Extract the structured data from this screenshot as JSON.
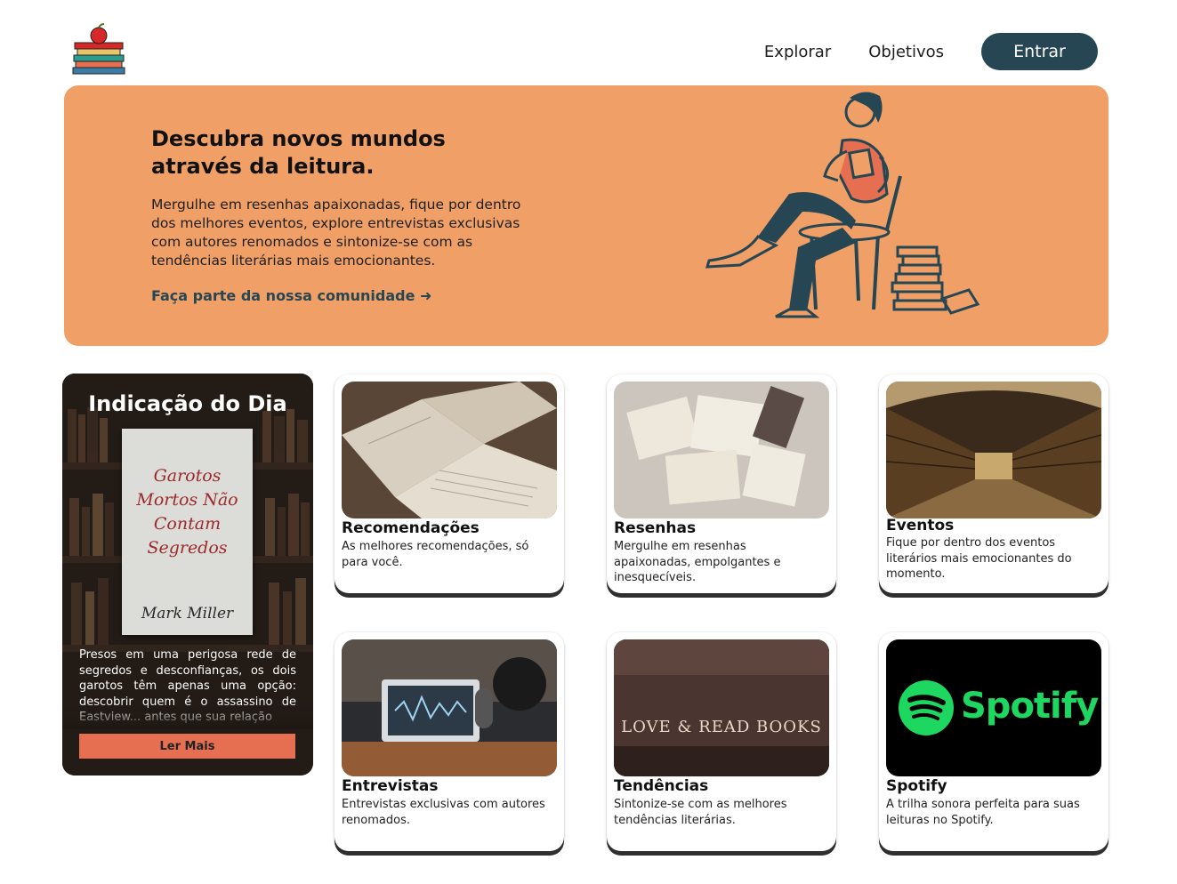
{
  "header": {
    "logo": "books-apple-logo-icon",
    "nav": [
      {
        "label": "Explorar"
      },
      {
        "label": "Objetivos"
      }
    ],
    "login_label": "Entrar"
  },
  "hero": {
    "title": "Descubra novos mundos através da leitura.",
    "text": "Mergulhe em resenhas apaixonadas, fique por dentro dos melhores eventos, explore entrevistas exclusivas com autores renomados e sintonize-se com as tendências literárias mais emocionantes.",
    "link": "Faça parte da nossa comunidade ➜",
    "illustration": "person-reading-chair-illustration"
  },
  "daily": {
    "title": "Indicação do Dia",
    "book": {
      "title": "Garotos Mortos Não Contam Segredos",
      "author": "Mark Miller"
    },
    "text": "Presos em uma perigosa rede de segredos e desconfianças, os dois garotos têm apenas uma opção: descobrir quem é o assassino de Eastview... antes que sua relação",
    "button": "Ler Mais"
  },
  "cards": [
    {
      "title": "Recomendações",
      "desc": "As melhores recomendações, só para você."
    },
    {
      "title": "Resenhas",
      "desc": "Mergulhe em resenhas apaixonadas, empolgantes e inesquecíveis."
    },
    {
      "title": "Eventos",
      "desc": "Fique por dentro dos eventos literários mais emocionantes do momento."
    },
    {
      "title": "Entrevistas",
      "desc": "Entrevistas exclusivas com autores renomados."
    },
    {
      "title": "Tendências",
      "desc": "Sintonize-se com as melhores tendências literárias.",
      "image_text": "LOVE & READ BOOKS"
    },
    {
      "title": "Spotify",
      "desc": "A trilha sonora perfeita para suas leituras no Spotify.",
      "image_text": "Spotify"
    }
  ],
  "colors": {
    "hero_bg": "#f0a066",
    "primary_dark": "#264653",
    "accent": "#e76f51",
    "spotify_green": "#1ed760"
  }
}
